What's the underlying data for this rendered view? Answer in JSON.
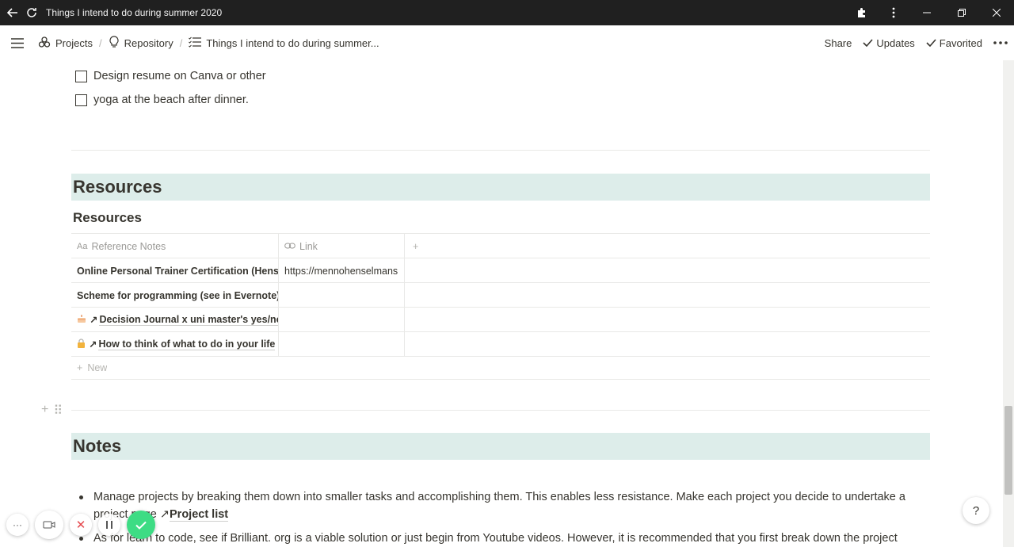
{
  "window": {
    "title": "Things I intend to do during summer 2020"
  },
  "breadcrumb": {
    "items": [
      {
        "label": "Projects",
        "icon": "projects-icon"
      },
      {
        "label": "Repository",
        "icon": "lightbulb-icon"
      },
      {
        "label": "Things I intend to do during summer...",
        "icon": "list-icon"
      }
    ]
  },
  "top_actions": {
    "share": "Share",
    "updates": "Updates",
    "favorited": "Favorited"
  },
  "todos": [
    {
      "label": "Design resume on Canva or other",
      "checked": false
    },
    {
      "label": "yoga at the beach after dinner.",
      "checked": false
    }
  ],
  "resources_section": {
    "heading": "Resources",
    "database_title": "Resources",
    "columns": [
      {
        "label": "Reference Notes",
        "icon": "text-type-icon"
      },
      {
        "label": "Link",
        "icon": "link-icon"
      }
    ],
    "rows": [
      {
        "name": "Online Personal Trainer Certification (Hense",
        "link": "https://mennohenselmans"
      },
      {
        "name": "Scheme for programming (see in Evernote)",
        "link": ""
      },
      {
        "name": "Decision Journal x uni master's yes/no",
        "link": "",
        "icon": "cake-icon"
      },
      {
        "name": "How to think of what to do in your life",
        "link": "",
        "icon": "lock-icon"
      }
    ],
    "new_label": "New"
  },
  "notes_section": {
    "heading": "Notes",
    "bullets": [
      {
        "text": "Manage projects by breaking them down into smaller tasks and accomplishing them. This enables less resistance. Make each project you decide to undertake a project page",
        "link": "Project list"
      },
      {
        "text": "As for learn to code, see if Brilliant. org is a viable solution or just begin from Youtube videos. However, it is recommended that you first break down the project"
      }
    ]
  },
  "help": {
    "label": "?"
  },
  "colors": {
    "titlebar": "#202020",
    "heading_band": "#ddedea",
    "confirm_button": "#3ddc84"
  }
}
